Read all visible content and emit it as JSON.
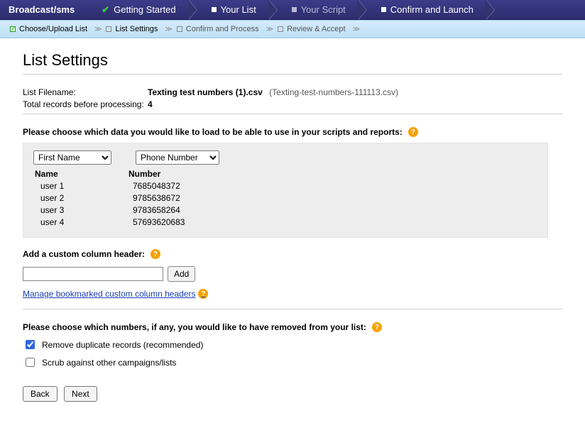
{
  "wizard": {
    "title": "Broadcast/sms",
    "steps": [
      {
        "label": "Getting Started",
        "state": "done"
      },
      {
        "label": "Your List",
        "state": "current"
      },
      {
        "label": "Your Script",
        "state": "todo-dim"
      },
      {
        "label": "Confirm and Launch",
        "state": "todo"
      }
    ]
  },
  "subnav": [
    {
      "label": "Choose/Upload List",
      "state": "done"
    },
    {
      "label": "List Settings",
      "state": "current"
    },
    {
      "label": "Confirm and Process",
      "state": "todo"
    },
    {
      "label": "Review & Accept",
      "state": "todo"
    }
  ],
  "page_title": "List Settings",
  "file_meta": {
    "label_filename": "List Filename:",
    "filename": "Texting test numbers (1).csv",
    "filename_alt": "(Texting-test-numbers-111113.csv)",
    "label_total": "Total records before processing:",
    "total_records": "4"
  },
  "choose_data": {
    "prompt": "Please choose which data you would like to load to be able to use in your scripts and reports:",
    "select1": "First Name",
    "select2": "Phone Number",
    "col1_header": "Name",
    "col2_header": "Number",
    "rows": [
      {
        "name": "user 1",
        "number": "7685048372"
      },
      {
        "name": "user 2",
        "number": "9785638672"
      },
      {
        "name": "user 3",
        "number": "9783658264"
      },
      {
        "name": "user 4",
        "number": "57693620683"
      }
    ]
  },
  "custom_column": {
    "prompt": "Add a custom column header:",
    "add_label": "Add",
    "link_text": "Manage bookmarked custom column headers"
  },
  "remove_section": {
    "prompt": "Please choose which numbers, if any, you would like to have removed from your list:",
    "opt1_label": "Remove duplicate records (recommended)",
    "opt1_checked": true,
    "opt2_label": "Scrub against other campaigns/lists",
    "opt2_checked": false
  },
  "buttons": {
    "back": "Back",
    "next": "Next"
  }
}
